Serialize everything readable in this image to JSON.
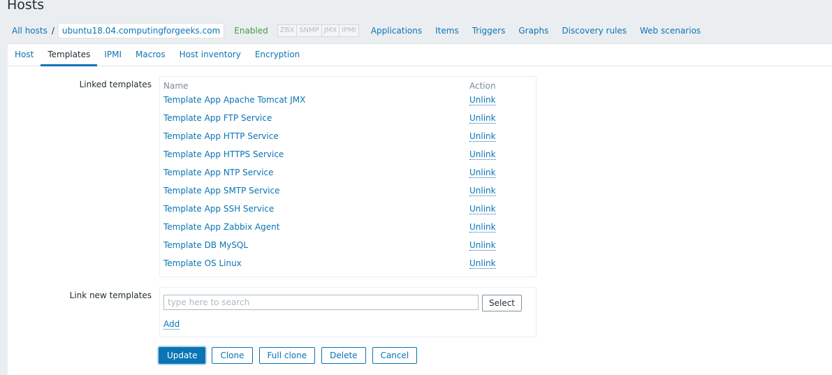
{
  "page": {
    "title": "Hosts"
  },
  "hostnav": {
    "all_hosts": "All hosts",
    "separator": "/",
    "host_name": "ubuntu18.04.computingforgeeks.com",
    "status": "Enabled",
    "availability": [
      "ZBX",
      "SNMP",
      "JMX",
      "IPMI"
    ],
    "links": [
      "Applications",
      "Items",
      "Triggers",
      "Graphs",
      "Discovery rules",
      "Web scenarios"
    ]
  },
  "tabs": [
    {
      "label": "Host"
    },
    {
      "label": "Templates",
      "active": true
    },
    {
      "label": "IPMI"
    },
    {
      "label": "Macros"
    },
    {
      "label": "Host inventory"
    },
    {
      "label": "Encryption"
    }
  ],
  "linked_templates": {
    "label": "Linked templates",
    "columns": {
      "name": "Name",
      "action": "Action"
    },
    "action_label": "Unlink",
    "rows": [
      "Template App Apache Tomcat JMX",
      "Template App FTP Service",
      "Template App HTTP Service",
      "Template App HTTPS Service",
      "Template App NTP Service",
      "Template App SMTP Service",
      "Template App SSH Service",
      "Template App Zabbix Agent",
      "Template DB MySQL",
      "Template OS Linux"
    ]
  },
  "link_new": {
    "label": "Link new templates",
    "placeholder": "type here to search",
    "select_label": "Select",
    "add_label": "Add"
  },
  "buttons": {
    "update": "Update",
    "clone": "Clone",
    "full_clone": "Full clone",
    "delete": "Delete",
    "cancel": "Cancel"
  },
  "colors": {
    "link": "#0a74b5",
    "enabled": "#429e47",
    "background": "#ebeef0"
  }
}
